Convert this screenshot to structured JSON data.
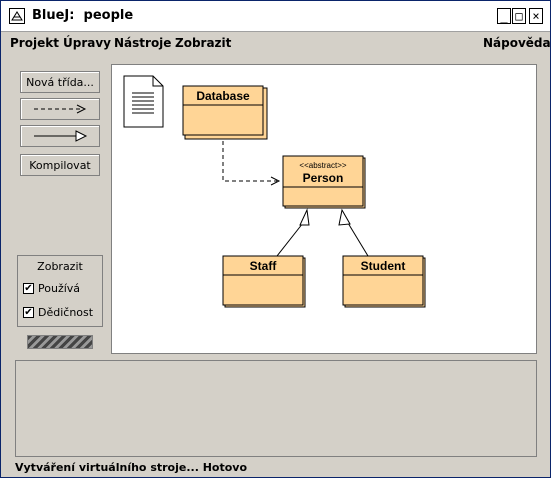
{
  "window": {
    "app_name": "BlueJ:",
    "project_name": "people",
    "minimize": "_",
    "maximize": "□",
    "close": "×"
  },
  "menubar": {
    "items": [
      "Projekt",
      "Úpravy",
      "Nástroje",
      "Zobrazit"
    ],
    "help": "Nápověda"
  },
  "sidebar": {
    "new_class": "Nová třída...",
    "compile": "Kompilovat"
  },
  "view_panel": {
    "title": "Zobrazit",
    "uses_label": "Používá",
    "uses_checked": true,
    "inheritance_label": "Dědičnost",
    "inheritance_checked": true,
    "check_mark": "✔"
  },
  "diagram": {
    "classes": {
      "database": {
        "name": "Database"
      },
      "person": {
        "stereotype": "<<abstract>>",
        "name": "Person"
      },
      "staff": {
        "name": "Staff"
      },
      "student": {
        "name": "Student"
      }
    },
    "colors": {
      "class_fill": "#ffd596",
      "class_border": "#000000"
    }
  },
  "status": {
    "text": "Vytváření virtuálního stroje... Hotovo"
  }
}
